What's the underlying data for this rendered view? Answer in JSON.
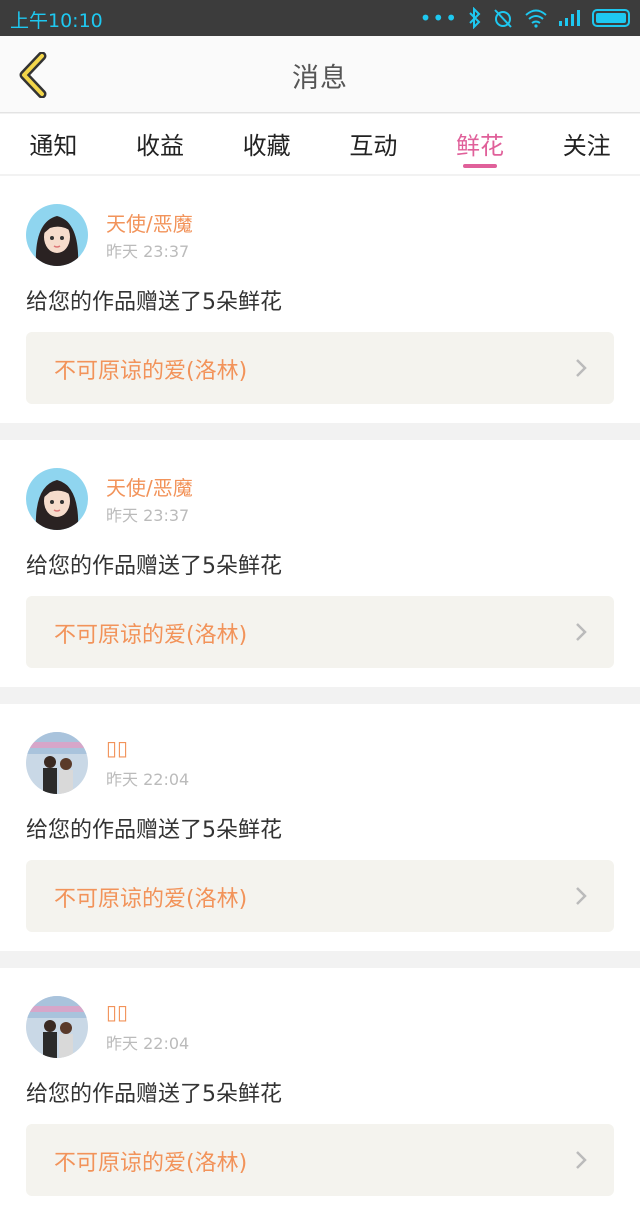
{
  "status": {
    "time": "上午10:10",
    "accent": "#1ec8f0"
  },
  "header": {
    "title": "消息",
    "back_icon": "chevron-left-icon"
  },
  "tabs": [
    {
      "label": "通知",
      "active": false
    },
    {
      "label": "收益",
      "active": false
    },
    {
      "label": "收藏",
      "active": false
    },
    {
      "label": "互动",
      "active": false
    },
    {
      "label": "鲜花",
      "active": true
    },
    {
      "label": "关注",
      "active": false
    }
  ],
  "messages": [
    {
      "name": "天使/恶魔",
      "time": "昨天 23:37",
      "text": "给您的作品赠送了5朵鲜花",
      "work": "不可原谅的爱(洛林)",
      "avatar": "girl"
    },
    {
      "name": "天使/恶魔",
      "time": "昨天 23:37",
      "text": "给您的作品赠送了5朵鲜花",
      "work": "不可原谅的爱(洛林)",
      "avatar": "girl"
    },
    {
      "name": "▯▯",
      "time": "昨天 22:04",
      "text": "给您的作品赠送了5朵鲜花",
      "work": "不可原谅的爱(洛林)",
      "avatar": "couple"
    },
    {
      "name": "▯▯",
      "time": "昨天 22:04",
      "text": "给您的作品赠送了5朵鲜花",
      "work": "不可原谅的爱(洛林)",
      "avatar": "couple"
    }
  ],
  "colors": {
    "active_tab": "#e0609a",
    "name": "#f2935a",
    "work_bg": "#f4f3ee"
  }
}
